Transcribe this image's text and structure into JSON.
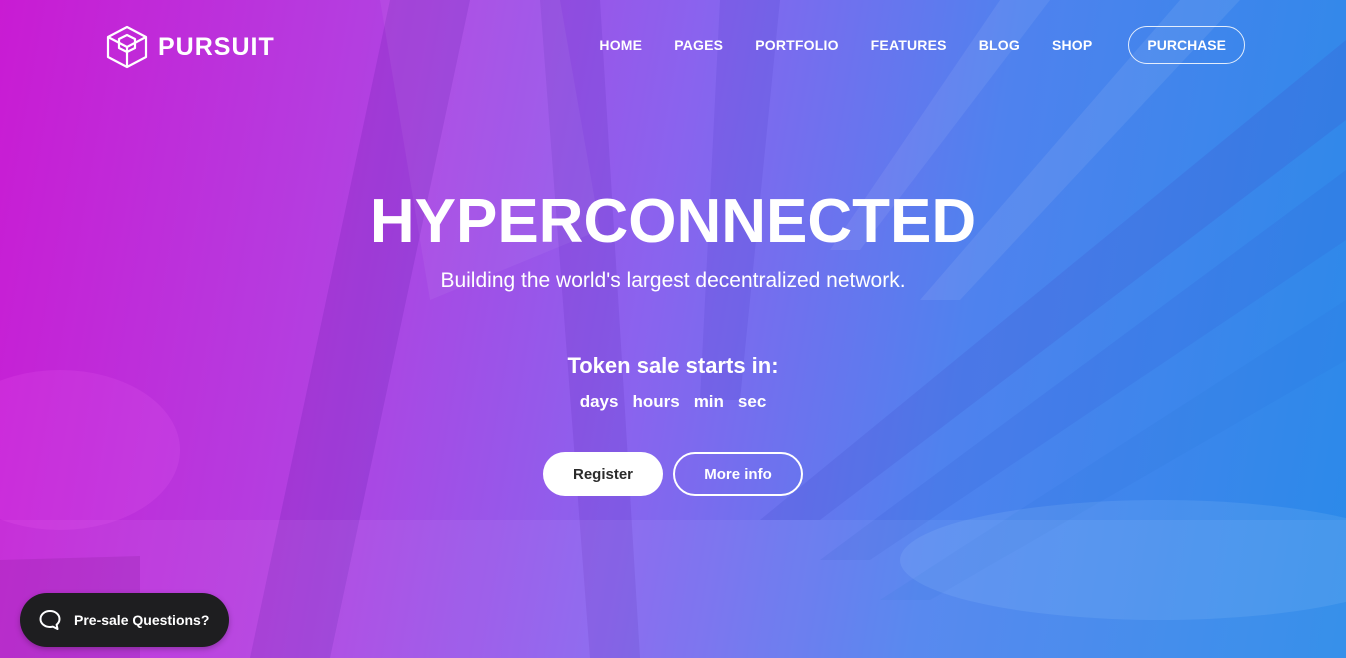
{
  "brand": {
    "name": "PURSUIT",
    "logo_icon": "cube-outline-icon"
  },
  "nav": {
    "items": [
      "HOME",
      "PAGES",
      "PORTFOLIO",
      "FEATURES",
      "BLOG",
      "SHOP"
    ],
    "purchase_label": "PURCHASE"
  },
  "hero": {
    "headline": "HYPERCONNECTED",
    "subline": "Building the world's largest decentralized network.",
    "token_label": "Token sale starts in:",
    "countdown": [
      "days",
      "hours",
      "min",
      "sec"
    ],
    "register_label": "Register",
    "more_info_label": "More info"
  },
  "chat": {
    "label": "Pre-sale Questions?",
    "icon": "chat-bubble-icon"
  },
  "colors": {
    "gradient_left": "#c91bd3",
    "gradient_mid": "#8a63ee",
    "gradient_right": "#2a8ae9",
    "chat_bg": "#1e1e20"
  }
}
